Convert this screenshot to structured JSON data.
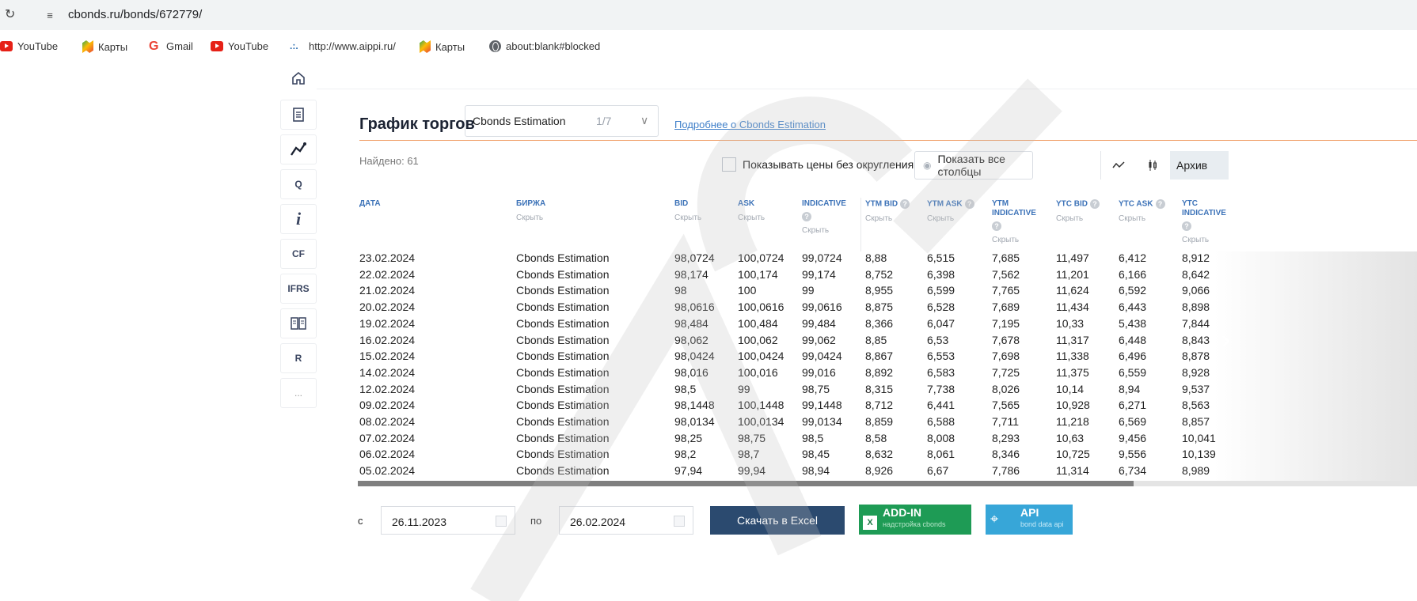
{
  "browser": {
    "url": "cbonds.ru/bonds/672779/",
    "bookmarks": [
      {
        "label": "YouTube",
        "icon": "youtube-icon"
      },
      {
        "label": "Карты",
        "icon": "maps-icon"
      },
      {
        "label": "Gmail",
        "icon": "gmail-icon"
      },
      {
        "label": "YouTube",
        "icon": "youtube-icon"
      },
      {
        "label": "http://www.aippi.ru/",
        "icon": "aippi-icon"
      },
      {
        "label": "Карты",
        "icon": "maps-icon"
      },
      {
        "label": "about:blank#blocked",
        "icon": "globe-icon"
      }
    ]
  },
  "leftnav": [
    "home-icon",
    "document-icon",
    "chart-icon",
    "Q",
    "i",
    "CF",
    "IFRS",
    "book-icon",
    "R",
    "..."
  ],
  "header": {
    "title": "График торгов",
    "source_select": "Cbonds Estimation",
    "source_count": "1/7",
    "more_link": "Подробнее о Cbonds Estimation"
  },
  "toolbar": {
    "found": "Найдено: 61",
    "no_round_label": "Показывать цены без округления",
    "show_cols": "Показать все столбцы",
    "archive": "Архив"
  },
  "columns": {
    "date": "ДАТА",
    "exchange": "БИРЖА",
    "bid": "BID",
    "ask": "ASK",
    "indicative": "INDICATIVE",
    "ytm_bid": "YTM BID",
    "ytm_ask": "YTM ASK",
    "ytm_indicative": "YTM INDICATIVE",
    "ytc_bid": "YTC BID",
    "ytc_ask": "YTC ASK",
    "ytc_indicative": "YTC INDICATIVE",
    "hide": "Скрыть",
    "q": "?"
  },
  "rows": [
    [
      "23.02.2024",
      "Cbonds Estimation",
      "98,0724",
      "100,0724",
      "99,0724",
      "8,88",
      "6,515",
      "7,685",
      "11,497",
      "6,412",
      "8,912"
    ],
    [
      "22.02.2024",
      "Cbonds Estimation",
      "98,174",
      "100,174",
      "99,174",
      "8,752",
      "6,398",
      "7,562",
      "11,201",
      "6,166",
      "8,642"
    ],
    [
      "21.02.2024",
      "Cbonds Estimation",
      "98",
      "100",
      "99",
      "8,955",
      "6,599",
      "7,765",
      "11,624",
      "6,592",
      "9,066"
    ],
    [
      "20.02.2024",
      "Cbonds Estimation",
      "98,0616",
      "100,0616",
      "99,0616",
      "8,875",
      "6,528",
      "7,689",
      "11,434",
      "6,443",
      "8,898"
    ],
    [
      "19.02.2024",
      "Cbonds Estimation",
      "98,484",
      "100,484",
      "99,484",
      "8,366",
      "6,047",
      "7,195",
      "10,33",
      "5,438",
      "7,844"
    ],
    [
      "16.02.2024",
      "Cbonds Estimation",
      "98,062",
      "100,062",
      "99,062",
      "8,85",
      "6,53",
      "7,678",
      "11,317",
      "6,448",
      "8,843"
    ],
    [
      "15.02.2024",
      "Cbonds Estimation",
      "98,0424",
      "100,0424",
      "99,0424",
      "8,867",
      "6,553",
      "7,698",
      "11,338",
      "6,496",
      "8,878"
    ],
    [
      "14.02.2024",
      "Cbonds Estimation",
      "98,016",
      "100,016",
      "99,016",
      "8,892",
      "6,583",
      "7,725",
      "11,375",
      "6,559",
      "8,928"
    ],
    [
      "12.02.2024",
      "Cbonds Estimation",
      "98,5",
      "99",
      "98,75",
      "8,315",
      "7,738",
      "8,026",
      "10,14",
      "8,94",
      "9,537"
    ],
    [
      "09.02.2024",
      "Cbonds Estimation",
      "98,1448",
      "100,1448",
      "99,1448",
      "8,712",
      "6,441",
      "7,565",
      "10,928",
      "6,271",
      "8,563"
    ],
    [
      "08.02.2024",
      "Cbonds Estimation",
      "98,0134",
      "100,0134",
      "99,0134",
      "8,859",
      "6,588",
      "7,711",
      "11,218",
      "6,569",
      "8,857"
    ],
    [
      "07.02.2024",
      "Cbonds Estimation",
      "98,25",
      "98,75",
      "98,5",
      "8,58",
      "8,008",
      "8,293",
      "10,63",
      "9,456",
      "10,041"
    ],
    [
      "06.02.2024",
      "Cbonds Estimation",
      "98,2",
      "98,7",
      "98,45",
      "8,632",
      "8,061",
      "8,346",
      "10,725",
      "9,556",
      "10,139"
    ],
    [
      "05.02.2024",
      "Cbonds Estimation",
      "97,94",
      "99,94",
      "98,94",
      "8,926",
      "6,67",
      "7,786",
      "11,314",
      "6,734",
      "8,989"
    ]
  ],
  "footer": {
    "from_label": "с",
    "from_date": "26.11.2023",
    "to_label": "по",
    "to_date": "26.02.2024",
    "excel": "Скачать в Excel",
    "addin_title": "ADD-IN",
    "addin_sub": "надстройка cbonds",
    "api_title": "API",
    "api_sub": "bond data api"
  },
  "colors": {
    "accent_blue": "#3d73b8",
    "excel_btn": "#2b4a6f",
    "addin_green": "#1e9b55",
    "api_blue": "#37a6d8",
    "orange_rule": "#f0a06a"
  }
}
